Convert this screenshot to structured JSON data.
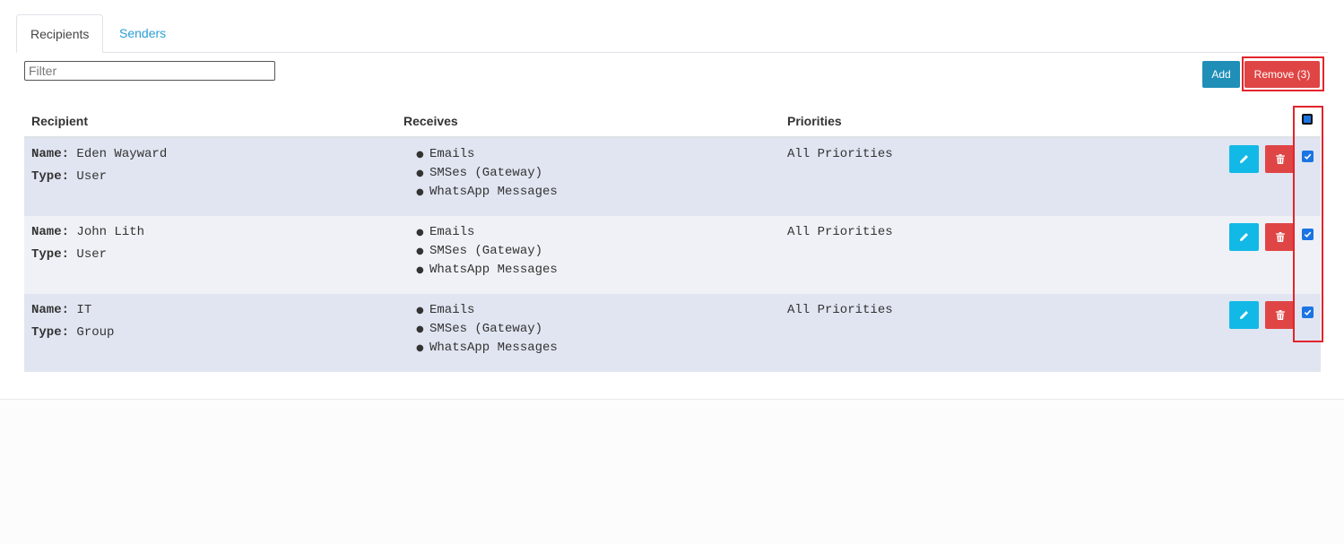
{
  "tabs": [
    {
      "label": "Recipients",
      "active": true
    },
    {
      "label": "Senders",
      "active": false
    }
  ],
  "filter": {
    "placeholder": "Filter",
    "value": ""
  },
  "toolbar": {
    "add_label": "Add",
    "remove_label": "Remove (3)"
  },
  "table": {
    "headers": {
      "recipient": "Recipient",
      "receives": "Receives",
      "priorities": "Priorities"
    },
    "header_checkbox_checked": true,
    "rows": [
      {
        "name_label": "Name:",
        "name": "Eden Wayward",
        "type_label": "Type:",
        "type": "User",
        "receives": [
          "Emails",
          "SMSes (Gateway)",
          "WhatsApp Messages"
        ],
        "priorities": "All Priorities",
        "checked": true
      },
      {
        "name_label": "Name:",
        "name": "John Lith",
        "type_label": "Type:",
        "type": "User",
        "receives": [
          "Emails",
          "SMSes (Gateway)",
          "WhatsApp Messages"
        ],
        "priorities": "All Priorities",
        "checked": true
      },
      {
        "name_label": "Name:",
        "name": "IT",
        "type_label": "Type:",
        "type": "Group",
        "receives": [
          "Emails",
          "SMSes (Gateway)",
          "WhatsApp Messages"
        ],
        "priorities": "All Priorities",
        "checked": true
      }
    ]
  },
  "icons": {
    "edit": "pencil-icon",
    "delete": "trash-icon",
    "check": "checkmark-icon"
  },
  "colors": {
    "tab_link": "#2a9fd6",
    "add_button": "#1f8fb8",
    "remove_button": "#e04545",
    "edit_button": "#13b9e6",
    "highlight_border": "#e3242b",
    "row_odd": "#e0e5f1",
    "row_even": "#f0f1f6"
  }
}
